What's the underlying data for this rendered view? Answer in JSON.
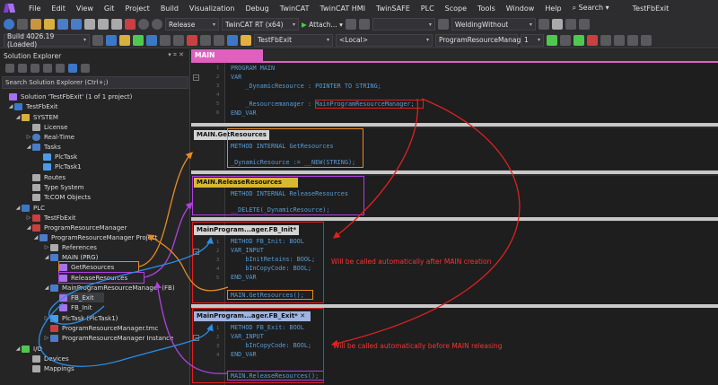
{
  "menubar": {
    "items": [
      "File",
      "Edit",
      "View",
      "Git",
      "Project",
      "Build",
      "Visualization",
      "Debug",
      "TwinCAT",
      "TwinCAT HMI",
      "TwinSAFE",
      "PLC",
      "Scope",
      "Tools",
      "Window",
      "Help"
    ],
    "search": "Search",
    "title": "TestFbExit"
  },
  "toolbar1": {
    "config": "Release",
    "platform": "TwinCAT RT (x64)",
    "attach": "Attach...",
    "search_combo": "WeldingWithout"
  },
  "toolbar2": {
    "build": "Build 4026.19 (Loaded)",
    "project": "TestFbExit",
    "target": "<Local>",
    "instance": "ProgramResourceManag",
    "count": "1"
  },
  "solution_explorer": {
    "title": "Solution Explorer",
    "search_placeholder": "Search Solution Explorer (Ctrl+;)",
    "items": [
      {
        "label": "Solution 'TestFbExit' (1 of 1 project)"
      },
      {
        "label": "TestFbExit"
      },
      {
        "label": "SYSTEM"
      },
      {
        "label": "License"
      },
      {
        "label": "Real-Time"
      },
      {
        "label": "Tasks"
      },
      {
        "label": "PlcTask"
      },
      {
        "label": "PlcTask1"
      },
      {
        "label": "Routes"
      },
      {
        "label": "Type System"
      },
      {
        "label": "TcCOM Objects"
      },
      {
        "label": "PLC"
      },
      {
        "label": "TestFbExit"
      },
      {
        "label": "ProgramResourceManager"
      },
      {
        "label": "ProgramResourceManager Project"
      },
      {
        "label": "References"
      },
      {
        "label": "MAIN (PRG)"
      },
      {
        "label": "GetResources"
      },
      {
        "label": "ReleaseResources"
      },
      {
        "label": "MainProgramResourceManager (FB)"
      },
      {
        "label": "FB_Exit"
      },
      {
        "label": "FB_Init"
      },
      {
        "label": "PlcTask (PlcTask1)"
      },
      {
        "label": "ProgramResourceManager.tmc"
      },
      {
        "label": "ProgramResourceManager Instance"
      },
      {
        "label": "I/O"
      },
      {
        "label": "Devices"
      },
      {
        "label": "Mappings"
      }
    ]
  },
  "editor": {
    "tab": "MAIN",
    "main_code": [
      "PROGRAM MAIN",
      "VAR",
      "    _DynamicResource : POINTER TO STRING;",
      "",
      "    _Resourcemanager : MainProgramResourceManager;",
      "END_VAR"
    ],
    "get_resources": {
      "title": "MAIN.GetResources",
      "decl": "METHOD INTERNAL GetResources",
      "body": "_DynamicResource := __NEW(STRING);"
    },
    "release_resources": {
      "title": "MAIN.ReleaseResources",
      "decl": "METHOD INTERNAL ReleaseResources",
      "body": "__DELETE(_DynamicResource);"
    },
    "fb_init": {
      "title": "MainProgram...ager.FB_Init*",
      "code": [
        "METHOD FB_Init: BOOL",
        "VAR_INPUT",
        "    bInitRetains: BOOL;",
        "    bInCopyCode: BOOL;",
        "END_VAR"
      ],
      "body": "MAIN.GetResources();",
      "note": "Will be called automatically after MAIN creation"
    },
    "fb_exit": {
      "title": "MainProgram...ager.FB_Exit*",
      "code": [
        "METHOD FB_Exit: BOOL",
        "VAR_INPUT",
        "    bInCopyCode: BOOL;",
        "END_VAR"
      ],
      "body": "MAIN.ReleaseResources();",
      "note": "Will be called automatically before MAIN releasing"
    }
  },
  "colors": {
    "orange": "#e88a23",
    "purple": "#b040e0",
    "red": "#e02020",
    "blue": "#2a8fe8",
    "pink": "#e060c0"
  }
}
